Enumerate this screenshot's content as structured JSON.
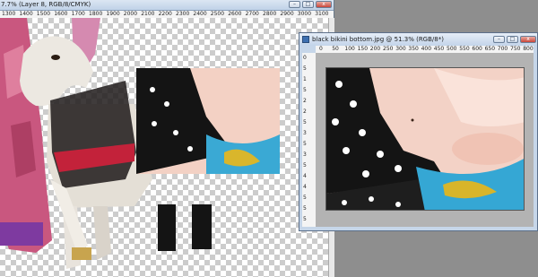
{
  "main_window": {
    "title": "7.7% (Layer 8, RGB/8/CMYK)",
    "controls": {
      "minimize": "–",
      "maximize": "□",
      "close": "x"
    },
    "ruler_ticks": [
      "1300",
      "1400",
      "1500",
      "1600",
      "1700",
      "1800",
      "1900",
      "2000",
      "2100",
      "2200",
      "2300",
      "2400",
      "2500",
      "2600",
      "2700",
      "2800",
      "2900",
      "3000",
      "3100"
    ]
  },
  "photo_window": {
    "title": "black bikini bottom.jpg @ 51.3% (RGB/8*)",
    "controls": {
      "minimize": "–",
      "maximize": "□",
      "close": "x"
    },
    "ruler_ticks_top": [
      "0",
      "50",
      "100",
      "150",
      "200",
      "250",
      "300",
      "350",
      "400",
      "450",
      "500",
      "550",
      "600",
      "650",
      "700",
      "750",
      "800"
    ],
    "ruler_ticks_left": [
      "0",
      "5",
      "1",
      "5",
      "2",
      "2",
      "5",
      "3",
      "5",
      "3",
      "5",
      "4",
      "4",
      "5",
      "5",
      "5"
    ]
  },
  "colors": {
    "pasteboard": "#b3b3b3",
    "workspace": "#8e8e8e"
  }
}
